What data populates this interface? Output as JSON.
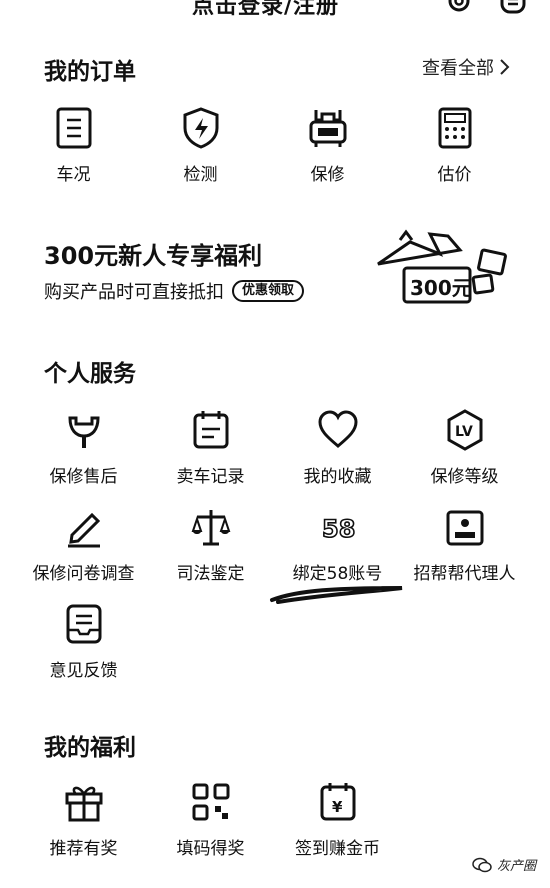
{
  "header": {
    "title": "点击登录/注册",
    "icons": [
      "settings-icon",
      "message-icon"
    ]
  },
  "orders": {
    "title": "我的订单",
    "view_all": "查看全部",
    "items": [
      {
        "label": "车况",
        "icon": "report-icon"
      },
      {
        "label": "检测",
        "icon": "shield-check-icon"
      },
      {
        "label": "保修",
        "icon": "wrench-car-icon"
      },
      {
        "label": "估价",
        "icon": "calculator-icon"
      }
    ]
  },
  "banner": {
    "title": "300元新人专享福利",
    "subtitle": "购买产品时可直接抵扣",
    "pill": "优惠领取",
    "art_text": "300元"
  },
  "services": {
    "title": "个人服务",
    "items": [
      {
        "label": "保修售后",
        "icon": "wrench-icon"
      },
      {
        "label": "卖车记录",
        "icon": "calendar-list-icon"
      },
      {
        "label": "我的收藏",
        "icon": "heart-icon"
      },
      {
        "label": "保修等级",
        "icon": "level-badge-icon",
        "badge": "LV"
      },
      {
        "label": "保修问卷调查",
        "icon": "pencil-icon"
      },
      {
        "label": "司法鉴定",
        "icon": "scales-icon"
      },
      {
        "label": "绑定58账号",
        "icon": "logo-58-icon",
        "badge": "58"
      },
      {
        "label": "招帮帮代理人",
        "icon": "id-card-icon"
      },
      {
        "label": "意见反馈",
        "icon": "feedback-box-icon"
      }
    ]
  },
  "benefits": {
    "title": "我的福利",
    "items": [
      {
        "label": "推荐有奖",
        "icon": "gift-icon"
      },
      {
        "label": "填码得奖",
        "icon": "qr-code-icon"
      },
      {
        "label": "签到赚金币",
        "icon": "calendar-yen-icon",
        "badge": "¥"
      }
    ]
  },
  "watermark": {
    "text": "灰产圈"
  }
}
